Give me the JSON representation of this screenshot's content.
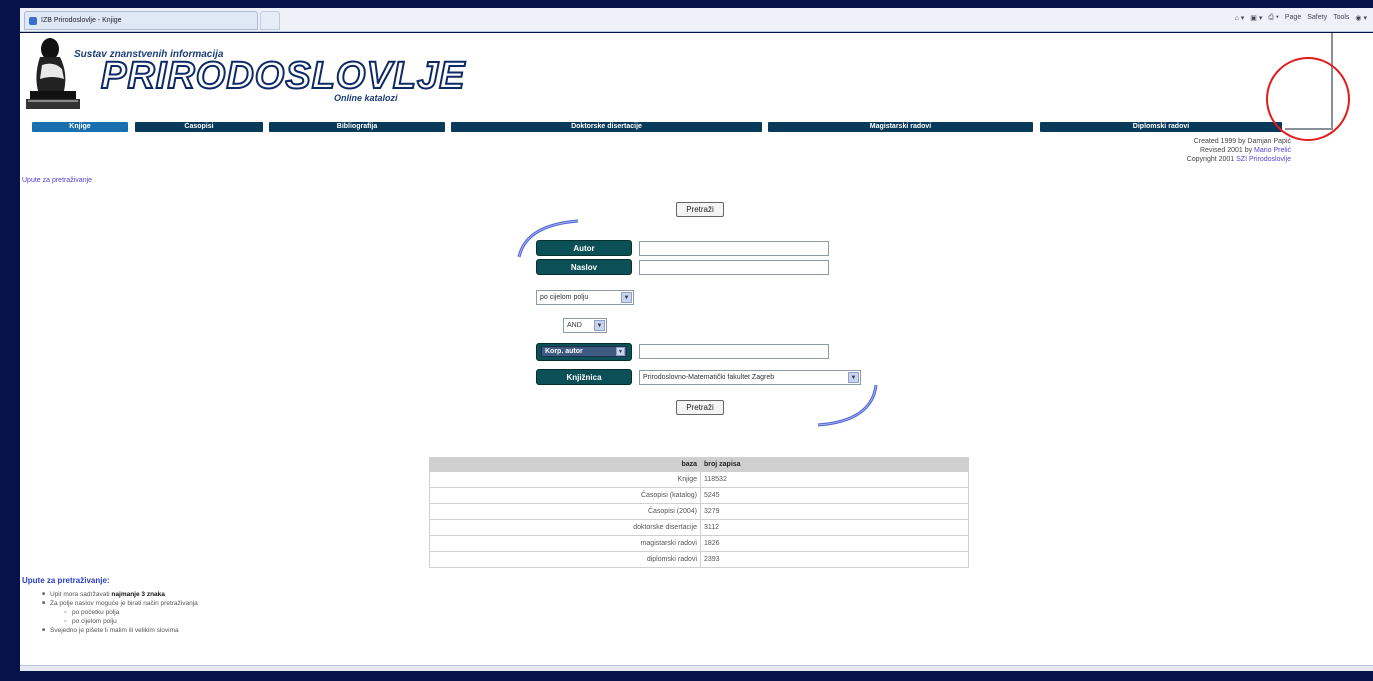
{
  "browser": {
    "tab_title": "IZB Prirodoslovlje - Knjige",
    "command_bar": [
      "Page",
      "Safety",
      "Tools"
    ]
  },
  "logo": {
    "subtitle": "Sustav znanstvenih informacija",
    "title": "PRIRODOSLOVLJE",
    "catalog": "Online katalozi"
  },
  "nav": {
    "items": [
      {
        "label": "Knjige"
      },
      {
        "label": "Časopisi"
      },
      {
        "label": "Bibliografija"
      },
      {
        "label": "Doktorske disertacije"
      },
      {
        "label": "Magistarski radovi"
      },
      {
        "label": "Diplomski radovi"
      }
    ]
  },
  "credits": {
    "line1": "Created 1999 by Damjan Papić",
    "line2_prefix": "Revised 2001 by ",
    "line2_link": "Mario Prelić",
    "line3_prefix": "Copyright 2001 ",
    "line3_link": "SZI Prirodoslovlje"
  },
  "help_link": "Upute za pretraživanje",
  "form": {
    "search_button": "Pretraži",
    "author_label": "Autor",
    "title_label": "Naslov",
    "field_mode": "po cijelom polju",
    "operator": "AND",
    "corp_author_label": "Korp. autor",
    "library_label": "Knjižnica",
    "library_value": "Prirodoslovno-Matematički fakultet Zagreb"
  },
  "stats": {
    "headers": [
      "baza",
      "broj zapisa"
    ],
    "rows": [
      [
        "Knjige",
        "118532"
      ],
      [
        "Časopisi (katalog)",
        "5245"
      ],
      [
        "Časopisi (2004)",
        "3279"
      ],
      [
        "doktorske disertacije",
        "3112"
      ],
      [
        "magistarski radovi",
        "1826"
      ],
      [
        "diplomski radovi",
        "2393"
      ]
    ]
  },
  "instructions": {
    "title": "Upute za pretraživanje:",
    "item1_prefix": "Upit mora sadržavati ",
    "item1_bold": "najmanje 3 znaka",
    "item2": "Za polje naslov moguće je birati način pretraživanja",
    "sub1": "po početku polja",
    "sub2": "po cijelom polju",
    "item3": "Svejedno je pišete li malim ili velikim slovima"
  },
  "colors": {
    "nav_bg": "#0a3a5a",
    "label_bg": "#0b5056",
    "link": "#5a3fd0",
    "frame_bg": "#08124a",
    "annotation_circle": "#e11c1c"
  }
}
